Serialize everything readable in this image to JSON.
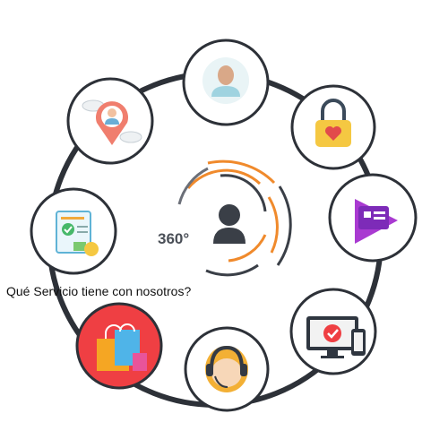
{
  "question_text": "Qué Servicio tiene con nosotros?",
  "center": {
    "label": "360°",
    "icon": "user-silhouette-icon"
  },
  "colors": {
    "ring": "#2d3138",
    "node_border": "#2d3138",
    "accent_orange": "#f08a2c",
    "center_gray": "#6b6f78",
    "center_dark": "#3a3f47",
    "highlight_fill": "#ef3f43"
  },
  "nodes": [
    {
      "id": "profile-user",
      "icon": "user-avatar-icon",
      "highlighted": false
    },
    {
      "id": "security",
      "icon": "padlock-heart-icon",
      "highlighted": false
    },
    {
      "id": "media-play",
      "icon": "play-store-icon",
      "highlighted": false
    },
    {
      "id": "device-check",
      "icon": "monitor-check-icon",
      "highlighted": false
    },
    {
      "id": "support",
      "icon": "headset-agent-icon",
      "highlighted": false
    },
    {
      "id": "shopping",
      "icon": "shopping-bags-icon",
      "highlighted": true
    },
    {
      "id": "billing",
      "icon": "invoice-check-icon",
      "highlighted": false
    },
    {
      "id": "location",
      "icon": "location-pin-user-icon",
      "highlighted": false
    }
  ]
}
